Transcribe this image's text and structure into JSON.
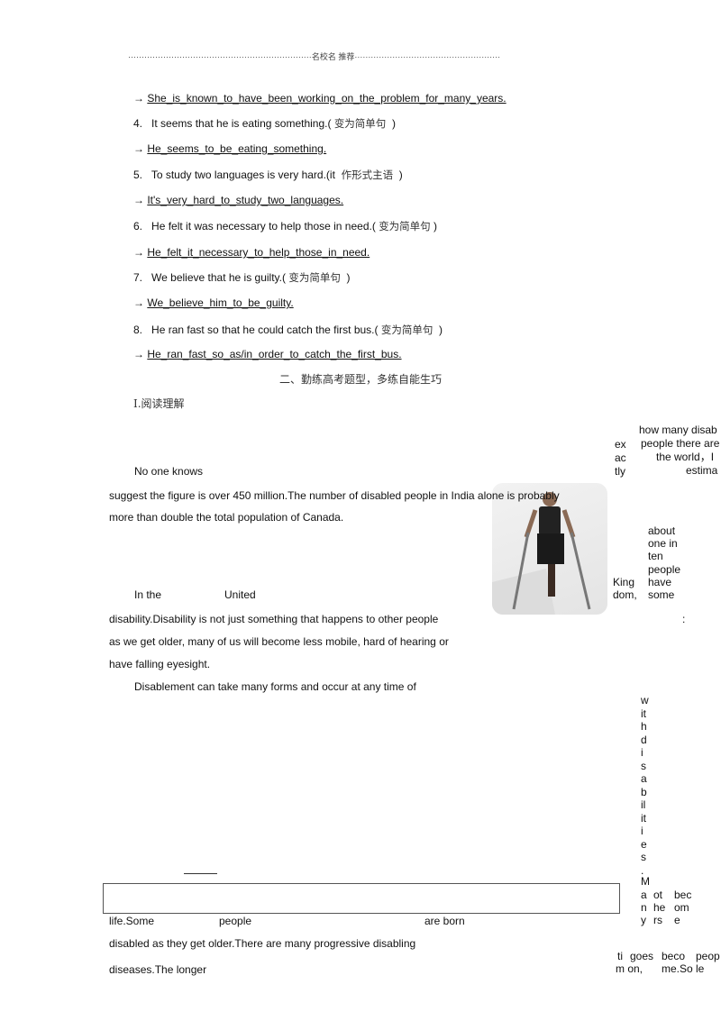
{
  "header": {
    "text": "名校名 推荐"
  },
  "exercises": [
    {
      "answer": "She_is_known_to_have_been_working_on_the_problem_for_many_years."
    },
    {
      "number": "4.",
      "question": "It seems that he is eating something.(",
      "hint": "变为简单句",
      "close": ")",
      "answer": "He_seems_to_be_eating_something."
    },
    {
      "number": "5.",
      "question": "To study two languages is very hard.(it",
      "hint": "作形式主语",
      "close": ")",
      "answer": "It's_very_hard_to_study_two_languages."
    },
    {
      "number": "6.",
      "question": "He felt it was necessary to help those in need.(",
      "hint": "变为简单句",
      "close": ")",
      "answer": "He_felt_it_necessary_to_help_those_in_need."
    },
    {
      "number": "7.",
      "question": "We believe that he is guilty.(",
      "hint": "变为简单句",
      "close": ")",
      "answer": "We_believe_him_to_be_guilty."
    },
    {
      "number": "8.",
      "question": "He ran fast so that he could catch the first bus.(",
      "hint": "变为简单句",
      "close": ")",
      "answer": "He_ran_fast_so_as/in_order_to_catch_the_first_bus."
    }
  ],
  "arrow": "→",
  "section_title": "二、勤练高考题型，多练自能生巧",
  "subsection": "Ⅰ.阅读理解",
  "passage": {
    "f1": "how many disab",
    "f2": "people there are",
    "f3": "the world，I",
    "f4": "estima",
    "ex": "ex",
    "ac": "ac",
    "tly": "tly",
    "p1": "No one knows",
    "p2": "suggest the figure is over 450 million.The number of disabled people in India alone is probably",
    "p3": "more than double the total population of Canada.",
    "uk1": "about",
    "uk2": "one in",
    "uk3": "ten",
    "uk4": "people",
    "uk5": "have",
    "uk6": "some",
    "king": "King",
    "dom": "dom,",
    "in_the": "In  the",
    "united": "United",
    "colon": ":",
    "p4": "disability.Disability is not just something that happens to other people",
    "p5": "as we get older, many of us will become less mobile, hard of hearing or",
    "p6": "have falling eyesight.",
    "p7": "Disablement  can  take  many  forms  and  occur  at  any  time  of",
    "vertical": "with disabilities.",
    "m1": "M",
    "m2": "a",
    "m3": "n",
    "m4": "y",
    "o1": "ot",
    "o2": "he",
    "o3": "rs",
    "b1": "bec",
    "b2": "om",
    "b3": "e",
    "life": "life.Some",
    "people": "people",
    "are_born": "are  born",
    "p8": "disabled  as  they  get  older.There  are  many  progressive  disabling",
    "p9": "diseases.The longer",
    "ti": "ti",
    "mon": "m on,",
    "goes": "goes",
    "beco": "beco",
    "me": "me.So",
    "peop": "peop",
    "le": "le"
  }
}
